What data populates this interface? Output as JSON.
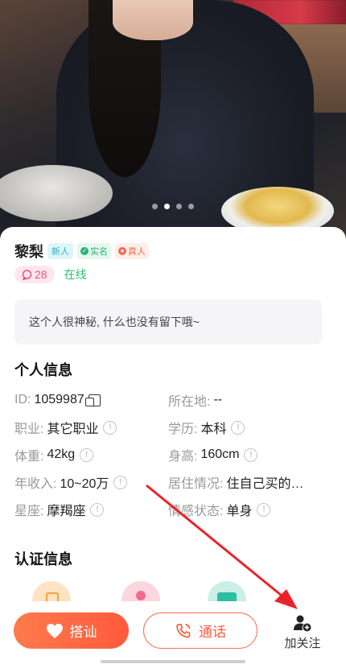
{
  "profile": {
    "name": "黎梨",
    "tags": {
      "new": "新人",
      "verified": "实名",
      "real": "真人"
    },
    "count": "28",
    "status": "在线",
    "bio": "这个人很神秘, 什么也没有留下哦~"
  },
  "photo": {
    "pages": 4,
    "active_page": 2
  },
  "personal": {
    "title": "个人信息",
    "rows": [
      [
        {
          "label": "ID:",
          "value": "1059987",
          "icon": "copy-icon"
        },
        {
          "label": "所在地:",
          "value": "--"
        }
      ],
      [
        {
          "label": "职业:",
          "value": "其它职业",
          "icon": "info-icon"
        },
        {
          "label": "学历:",
          "value": "本科",
          "icon": "info-icon"
        }
      ],
      [
        {
          "label": "体重:",
          "value": "42kg",
          "icon": "info-icon"
        },
        {
          "label": "身高:",
          "value": "160cm",
          "icon": "info-icon"
        }
      ],
      [
        {
          "label": "年收入:",
          "value": "10~20万",
          "icon": "info-icon"
        },
        {
          "label": "居住情况:",
          "value": "住自己买的…"
        }
      ],
      [
        {
          "label": "星座:",
          "value": "摩羯座",
          "icon": "info-icon"
        },
        {
          "label": "情感状态:",
          "value": "单身",
          "icon": "info-icon"
        }
      ]
    ]
  },
  "certification": {
    "title": "认证信息",
    "colors": [
      "#fde3c4",
      "#fbd6df",
      "#c9efe6"
    ]
  },
  "actions": {
    "chat": "搭讪",
    "call": "通话",
    "follow": "加关注"
  },
  "colors": {
    "accent": "#ff5a3c",
    "online": "#2cbf6d",
    "annotation_arrow": "#e8242a"
  }
}
